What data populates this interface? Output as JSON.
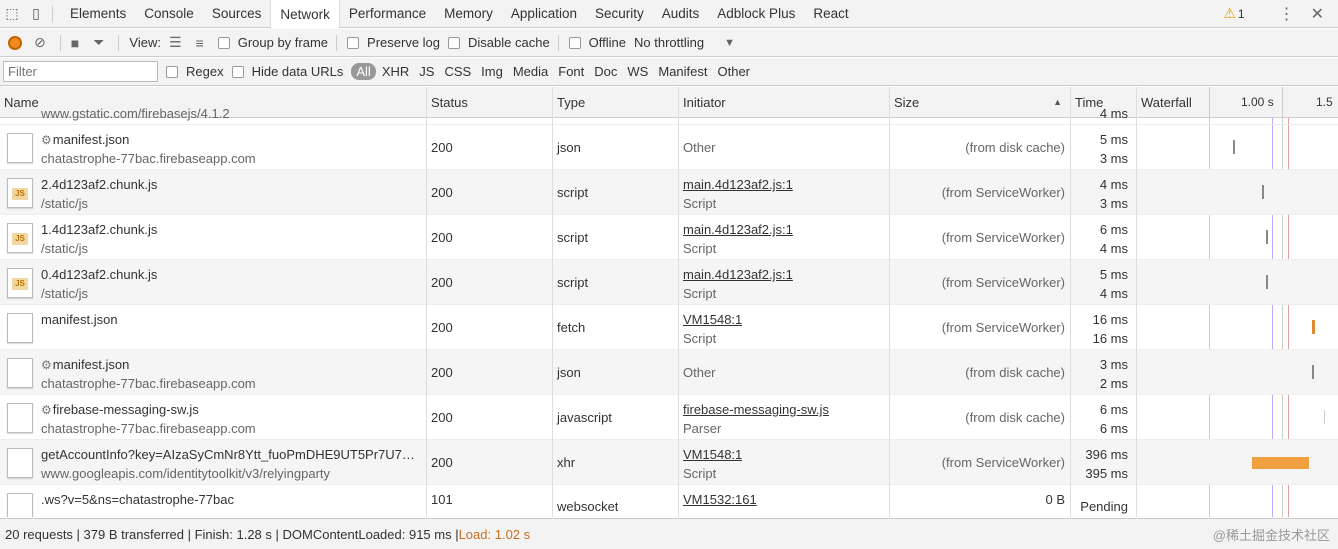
{
  "tabs": [
    "Elements",
    "Console",
    "Sources",
    "Network",
    "Performance",
    "Memory",
    "Application",
    "Security",
    "Audits",
    "Adblock Plus",
    "React"
  ],
  "active_tab": "Network",
  "warnings": {
    "count": "1"
  },
  "toolbar": {
    "view_label": "View:",
    "group_by_frame": "Group by frame",
    "preserve_log": "Preserve log",
    "disable_cache": "Disable cache",
    "offline": "Offline",
    "throttling": "No throttling"
  },
  "filter": {
    "placeholder": "Filter",
    "regex": "Regex",
    "hide_data_urls": "Hide data URLs",
    "types": [
      "All",
      "XHR",
      "JS",
      "CSS",
      "Img",
      "Media",
      "Font",
      "Doc",
      "WS",
      "Manifest",
      "Other"
    ],
    "active_type": "All"
  },
  "columns": {
    "name": "Name",
    "status": "Status",
    "type": "Type",
    "initiator": "Initiator",
    "size": "Size",
    "time": "Time",
    "waterfall": "Waterfall"
  },
  "waterfall_ticks": [
    "1.00 s",
    "1.5"
  ],
  "partial_top_row": {
    "name2": "www.gstatic.com/firebasejs/4.1.2",
    "time2": "4 ms"
  },
  "rows": [
    {
      "gear": true,
      "name": "manifest.json",
      "path": "chatastrophe-77bac.firebaseapp.com",
      "status": "200",
      "type": "json",
      "initiator": "Other",
      "initiator_link": false,
      "initiator_sub": "",
      "size": "(from disk cache)",
      "time1": "5 ms",
      "time2": "3 ms",
      "icon": "blank"
    },
    {
      "gear": false,
      "name": "2.4d123af2.chunk.js",
      "path": "/static/js",
      "status": "200",
      "type": "script",
      "initiator": "main.4d123af2.js:1",
      "initiator_link": true,
      "initiator_sub": "Script",
      "size": "(from ServiceWorker)",
      "time1": "4 ms",
      "time2": "3 ms",
      "icon": "js"
    },
    {
      "gear": false,
      "name": "1.4d123af2.chunk.js",
      "path": "/static/js",
      "status": "200",
      "type": "script",
      "initiator": "main.4d123af2.js:1",
      "initiator_link": true,
      "initiator_sub": "Script",
      "size": "(from ServiceWorker)",
      "time1": "6 ms",
      "time2": "4 ms",
      "icon": "js"
    },
    {
      "gear": false,
      "name": "0.4d123af2.chunk.js",
      "path": "/static/js",
      "status": "200",
      "type": "script",
      "initiator": "main.4d123af2.js:1",
      "initiator_link": true,
      "initiator_sub": "Script",
      "size": "(from ServiceWorker)",
      "time1": "5 ms",
      "time2": "4 ms",
      "icon": "js"
    },
    {
      "gear": false,
      "name": "manifest.json",
      "path": "",
      "status": "200",
      "type": "fetch",
      "initiator": "VM1548:1",
      "initiator_link": true,
      "initiator_sub": "Script",
      "size": "(from ServiceWorker)",
      "time1": "16 ms",
      "time2": "16 ms",
      "icon": "blank"
    },
    {
      "gear": true,
      "name": "manifest.json",
      "path": "chatastrophe-77bac.firebaseapp.com",
      "status": "200",
      "type": "json",
      "initiator": "Other",
      "initiator_link": false,
      "initiator_sub": "",
      "size": "(from disk cache)",
      "time1": "3 ms",
      "time2": "2 ms",
      "icon": "blank"
    },
    {
      "gear": true,
      "name": "firebase-messaging-sw.js",
      "path": "chatastrophe-77bac.firebaseapp.com",
      "status": "200",
      "type": "javascript",
      "initiator": "firebase-messaging-sw.js",
      "initiator_link": true,
      "initiator_sub": "Parser",
      "size": "(from disk cache)",
      "time1": "6 ms",
      "time2": "6 ms",
      "icon": "blank"
    },
    {
      "gear": false,
      "name": "getAccountInfo?key=AIzaSyCmNr8Ytt_fuoPmDHE9UT5Pr7U7…",
      "path": "www.googleapis.com/identitytoolkit/v3/relyingparty",
      "status": "200",
      "type": "xhr",
      "initiator": "VM1548:1",
      "initiator_link": true,
      "initiator_sub": "Script",
      "size": "(from ServiceWorker)",
      "time1": "396 ms",
      "time2": "395 ms",
      "icon": "blank"
    },
    {
      "gear": false,
      "name": ".ws?v=5&ns=chatastrophe-77bac",
      "path": "",
      "status": "101",
      "type": "websocket",
      "initiator": "VM1532:161",
      "initiator_link": true,
      "initiator_sub": "",
      "size": "0 B",
      "time1": "Pending",
      "time2": "",
      "icon": "blank"
    }
  ],
  "statusbar": {
    "summary": "20 requests | 379 B transferred | Finish: 1.28 s | DOMContentLoaded: 915 ms | ",
    "load": "Load: 1.02 s",
    "watermark": "@稀土掘金技术社区"
  },
  "colors": {
    "record": "#f28b1e",
    "bar_long": "#f0a040",
    "load_text": "#c87020"
  }
}
